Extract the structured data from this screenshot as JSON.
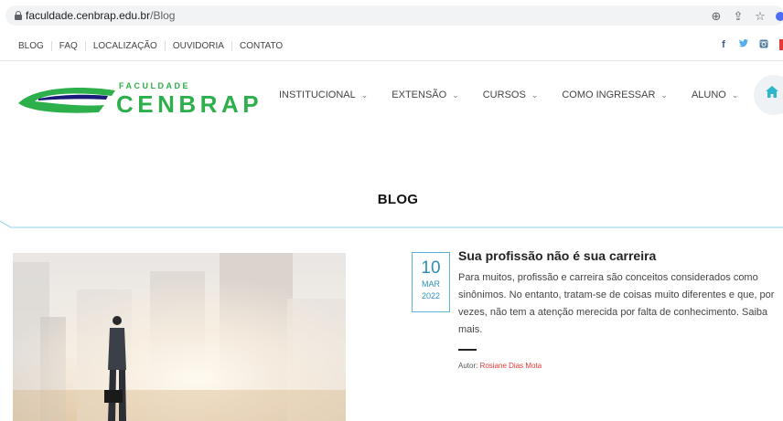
{
  "browser": {
    "url_domain": "faculdade.cenbrap.edu.br",
    "url_path": "/Blog"
  },
  "topnav": [
    "BLOG",
    "FAQ",
    "LOCALIZAÇÃO",
    "OUVIDORIA",
    "CONTATO"
  ],
  "social": {
    "facebook": "f",
    "twitter": "🐦",
    "instagram": "◘"
  },
  "logo": {
    "sub": "FACULDADE",
    "main": "CENBRAP"
  },
  "mainnav": [
    {
      "label": "INSTITUCIONAL",
      "chevron": "⌄"
    },
    {
      "label": "EXTENSÃO",
      "chevron": "⌄"
    },
    {
      "label": "CURSOS",
      "chevron": "⌄"
    },
    {
      "label": "COMO INGRESSAR",
      "chevron": "⌄"
    },
    {
      "label": "ALUNO",
      "chevron": "⌄"
    }
  ],
  "page_title": "BLOG",
  "post": {
    "day": "10",
    "month": "MAR",
    "year": "2022",
    "title": "Sua profissão não é sua carreira",
    "excerpt": "Para muitos, profissão e carreira são conceitos considerados como sinônimos. No entanto, tratam-se de coisas muito diferentes e que, por vezes, não tem a atenção merecida por falta de conhecimento. Saiba mais.",
    "author_label": "Autor:",
    "author_name": "Rosiane Dias Mota"
  },
  "colors": {
    "brand_green": "#2db04b",
    "accent_blue": "#2e8fb7",
    "author_red": "#e53935"
  }
}
